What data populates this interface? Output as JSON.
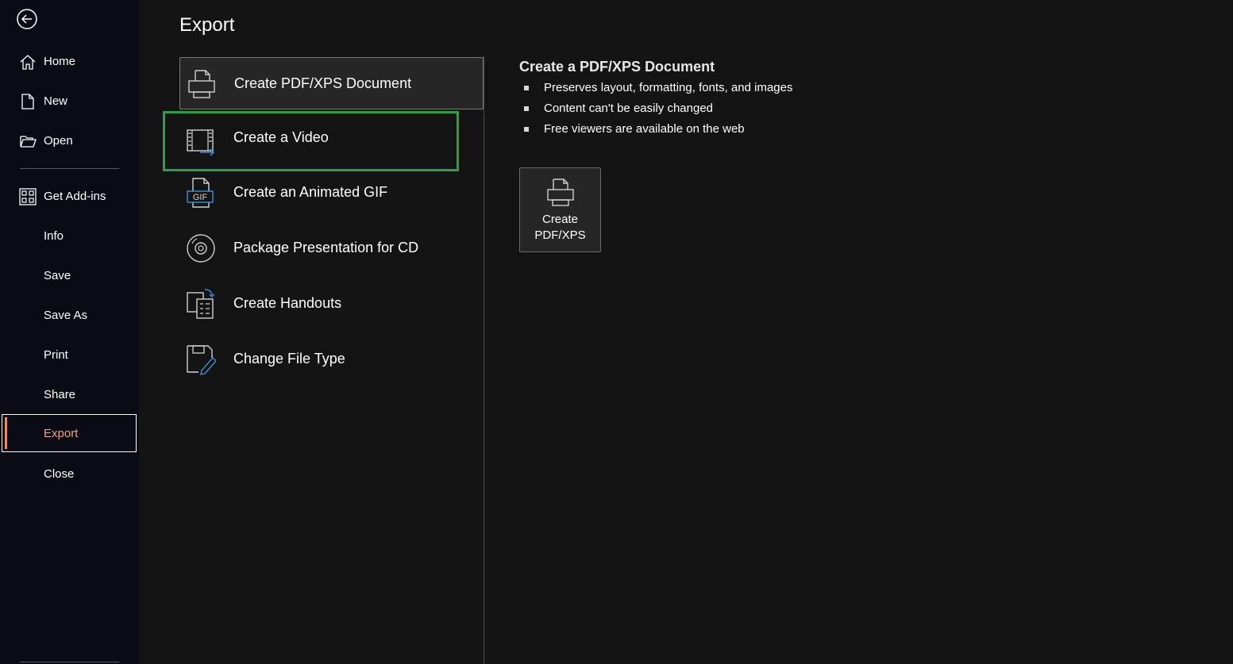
{
  "sidebar": {
    "items": [
      {
        "label": "Home",
        "icon": "home-icon"
      },
      {
        "label": "New",
        "icon": "new-document-icon"
      },
      {
        "label": "Open",
        "icon": "folder-open-icon"
      },
      {
        "label": "Get Add-ins",
        "icon": "add-ins-grid-icon"
      },
      {
        "label": "Info"
      },
      {
        "label": "Save"
      },
      {
        "label": "Save As"
      },
      {
        "label": "Print"
      },
      {
        "label": "Share"
      },
      {
        "label": "Export",
        "selected": true
      },
      {
        "label": "Close"
      }
    ]
  },
  "main": {
    "title": "Export",
    "options": [
      {
        "label": "Create PDF/XPS Document",
        "icon": "printer-document-icon",
        "state": "active"
      },
      {
        "label": "Create a Video",
        "icon": "video-film-icon",
        "state": "focused"
      },
      {
        "label": "Create an Animated GIF",
        "icon": "gif-document-icon"
      },
      {
        "label": "Package Presentation for CD",
        "icon": "cd-disc-icon"
      },
      {
        "label": "Create Handouts",
        "icon": "handouts-icon"
      },
      {
        "label": "Change File Type",
        "icon": "change-file-type-icon"
      }
    ]
  },
  "detail": {
    "title": "Create a PDF/XPS Document",
    "bullets": [
      "Preserves layout, formatting, fonts, and images",
      "Content can't be easily changed",
      "Free viewers are available on the web"
    ],
    "button": {
      "line1": "Create",
      "line2": "PDF/XPS"
    }
  },
  "colors": {
    "sidebar_bg": "#0b0b16",
    "main_bg": "#141414",
    "selected_accent": "#e8896c",
    "focus_outline": "#2ea043",
    "icon_blue": "#3a8fd9"
  }
}
